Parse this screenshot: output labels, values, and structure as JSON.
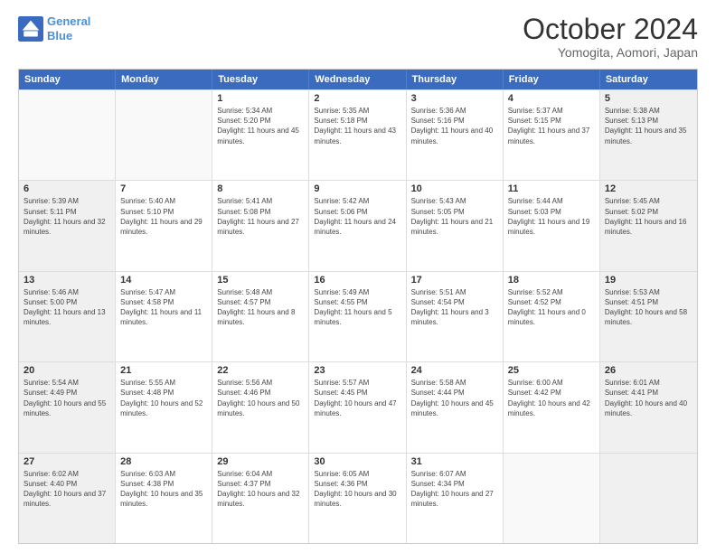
{
  "header": {
    "logo_line1": "General",
    "logo_line2": "Blue",
    "month": "October 2024",
    "location": "Yomogita, Aomori, Japan"
  },
  "weekdays": [
    "Sunday",
    "Monday",
    "Tuesday",
    "Wednesday",
    "Thursday",
    "Friday",
    "Saturday"
  ],
  "rows": [
    [
      {
        "day": "",
        "info": "",
        "empty": true
      },
      {
        "day": "",
        "info": "",
        "empty": true
      },
      {
        "day": "1",
        "info": "Sunrise: 5:34 AM\nSunset: 5:20 PM\nDaylight: 11 hours and 45 minutes.",
        "empty": false
      },
      {
        "day": "2",
        "info": "Sunrise: 5:35 AM\nSunset: 5:18 PM\nDaylight: 11 hours and 43 minutes.",
        "empty": false
      },
      {
        "day": "3",
        "info": "Sunrise: 5:36 AM\nSunset: 5:16 PM\nDaylight: 11 hours and 40 minutes.",
        "empty": false
      },
      {
        "day": "4",
        "info": "Sunrise: 5:37 AM\nSunset: 5:15 PM\nDaylight: 11 hours and 37 minutes.",
        "empty": false
      },
      {
        "day": "5",
        "info": "Sunrise: 5:38 AM\nSunset: 5:13 PM\nDaylight: 11 hours and 35 minutes.",
        "empty": false,
        "shaded": true
      }
    ],
    [
      {
        "day": "6",
        "info": "Sunrise: 5:39 AM\nSunset: 5:11 PM\nDaylight: 11 hours and 32 minutes.",
        "empty": false,
        "shaded": true
      },
      {
        "day": "7",
        "info": "Sunrise: 5:40 AM\nSunset: 5:10 PM\nDaylight: 11 hours and 29 minutes.",
        "empty": false
      },
      {
        "day": "8",
        "info": "Sunrise: 5:41 AM\nSunset: 5:08 PM\nDaylight: 11 hours and 27 minutes.",
        "empty": false
      },
      {
        "day": "9",
        "info": "Sunrise: 5:42 AM\nSunset: 5:06 PM\nDaylight: 11 hours and 24 minutes.",
        "empty": false
      },
      {
        "day": "10",
        "info": "Sunrise: 5:43 AM\nSunset: 5:05 PM\nDaylight: 11 hours and 21 minutes.",
        "empty": false
      },
      {
        "day": "11",
        "info": "Sunrise: 5:44 AM\nSunset: 5:03 PM\nDaylight: 11 hours and 19 minutes.",
        "empty": false
      },
      {
        "day": "12",
        "info": "Sunrise: 5:45 AM\nSunset: 5:02 PM\nDaylight: 11 hours and 16 minutes.",
        "empty": false,
        "shaded": true
      }
    ],
    [
      {
        "day": "13",
        "info": "Sunrise: 5:46 AM\nSunset: 5:00 PM\nDaylight: 11 hours and 13 minutes.",
        "empty": false,
        "shaded": true
      },
      {
        "day": "14",
        "info": "Sunrise: 5:47 AM\nSunset: 4:58 PM\nDaylight: 11 hours and 11 minutes.",
        "empty": false
      },
      {
        "day": "15",
        "info": "Sunrise: 5:48 AM\nSunset: 4:57 PM\nDaylight: 11 hours and 8 minutes.",
        "empty": false
      },
      {
        "day": "16",
        "info": "Sunrise: 5:49 AM\nSunset: 4:55 PM\nDaylight: 11 hours and 5 minutes.",
        "empty": false
      },
      {
        "day": "17",
        "info": "Sunrise: 5:51 AM\nSunset: 4:54 PM\nDaylight: 11 hours and 3 minutes.",
        "empty": false
      },
      {
        "day": "18",
        "info": "Sunrise: 5:52 AM\nSunset: 4:52 PM\nDaylight: 11 hours and 0 minutes.",
        "empty": false
      },
      {
        "day": "19",
        "info": "Sunrise: 5:53 AM\nSunset: 4:51 PM\nDaylight: 10 hours and 58 minutes.",
        "empty": false,
        "shaded": true
      }
    ],
    [
      {
        "day": "20",
        "info": "Sunrise: 5:54 AM\nSunset: 4:49 PM\nDaylight: 10 hours and 55 minutes.",
        "empty": false,
        "shaded": true
      },
      {
        "day": "21",
        "info": "Sunrise: 5:55 AM\nSunset: 4:48 PM\nDaylight: 10 hours and 52 minutes.",
        "empty": false
      },
      {
        "day": "22",
        "info": "Sunrise: 5:56 AM\nSunset: 4:46 PM\nDaylight: 10 hours and 50 minutes.",
        "empty": false
      },
      {
        "day": "23",
        "info": "Sunrise: 5:57 AM\nSunset: 4:45 PM\nDaylight: 10 hours and 47 minutes.",
        "empty": false
      },
      {
        "day": "24",
        "info": "Sunrise: 5:58 AM\nSunset: 4:44 PM\nDaylight: 10 hours and 45 minutes.",
        "empty": false
      },
      {
        "day": "25",
        "info": "Sunrise: 6:00 AM\nSunset: 4:42 PM\nDaylight: 10 hours and 42 minutes.",
        "empty": false
      },
      {
        "day": "26",
        "info": "Sunrise: 6:01 AM\nSunset: 4:41 PM\nDaylight: 10 hours and 40 minutes.",
        "empty": false,
        "shaded": true
      }
    ],
    [
      {
        "day": "27",
        "info": "Sunrise: 6:02 AM\nSunset: 4:40 PM\nDaylight: 10 hours and 37 minutes.",
        "empty": false,
        "shaded": true
      },
      {
        "day": "28",
        "info": "Sunrise: 6:03 AM\nSunset: 4:38 PM\nDaylight: 10 hours and 35 minutes.",
        "empty": false
      },
      {
        "day": "29",
        "info": "Sunrise: 6:04 AM\nSunset: 4:37 PM\nDaylight: 10 hours and 32 minutes.",
        "empty": false
      },
      {
        "day": "30",
        "info": "Sunrise: 6:05 AM\nSunset: 4:36 PM\nDaylight: 10 hours and 30 minutes.",
        "empty": false
      },
      {
        "day": "31",
        "info": "Sunrise: 6:07 AM\nSunset: 4:34 PM\nDaylight: 10 hours and 27 minutes.",
        "empty": false
      },
      {
        "day": "",
        "info": "",
        "empty": true
      },
      {
        "day": "",
        "info": "",
        "empty": true,
        "shaded": true
      }
    ]
  ]
}
